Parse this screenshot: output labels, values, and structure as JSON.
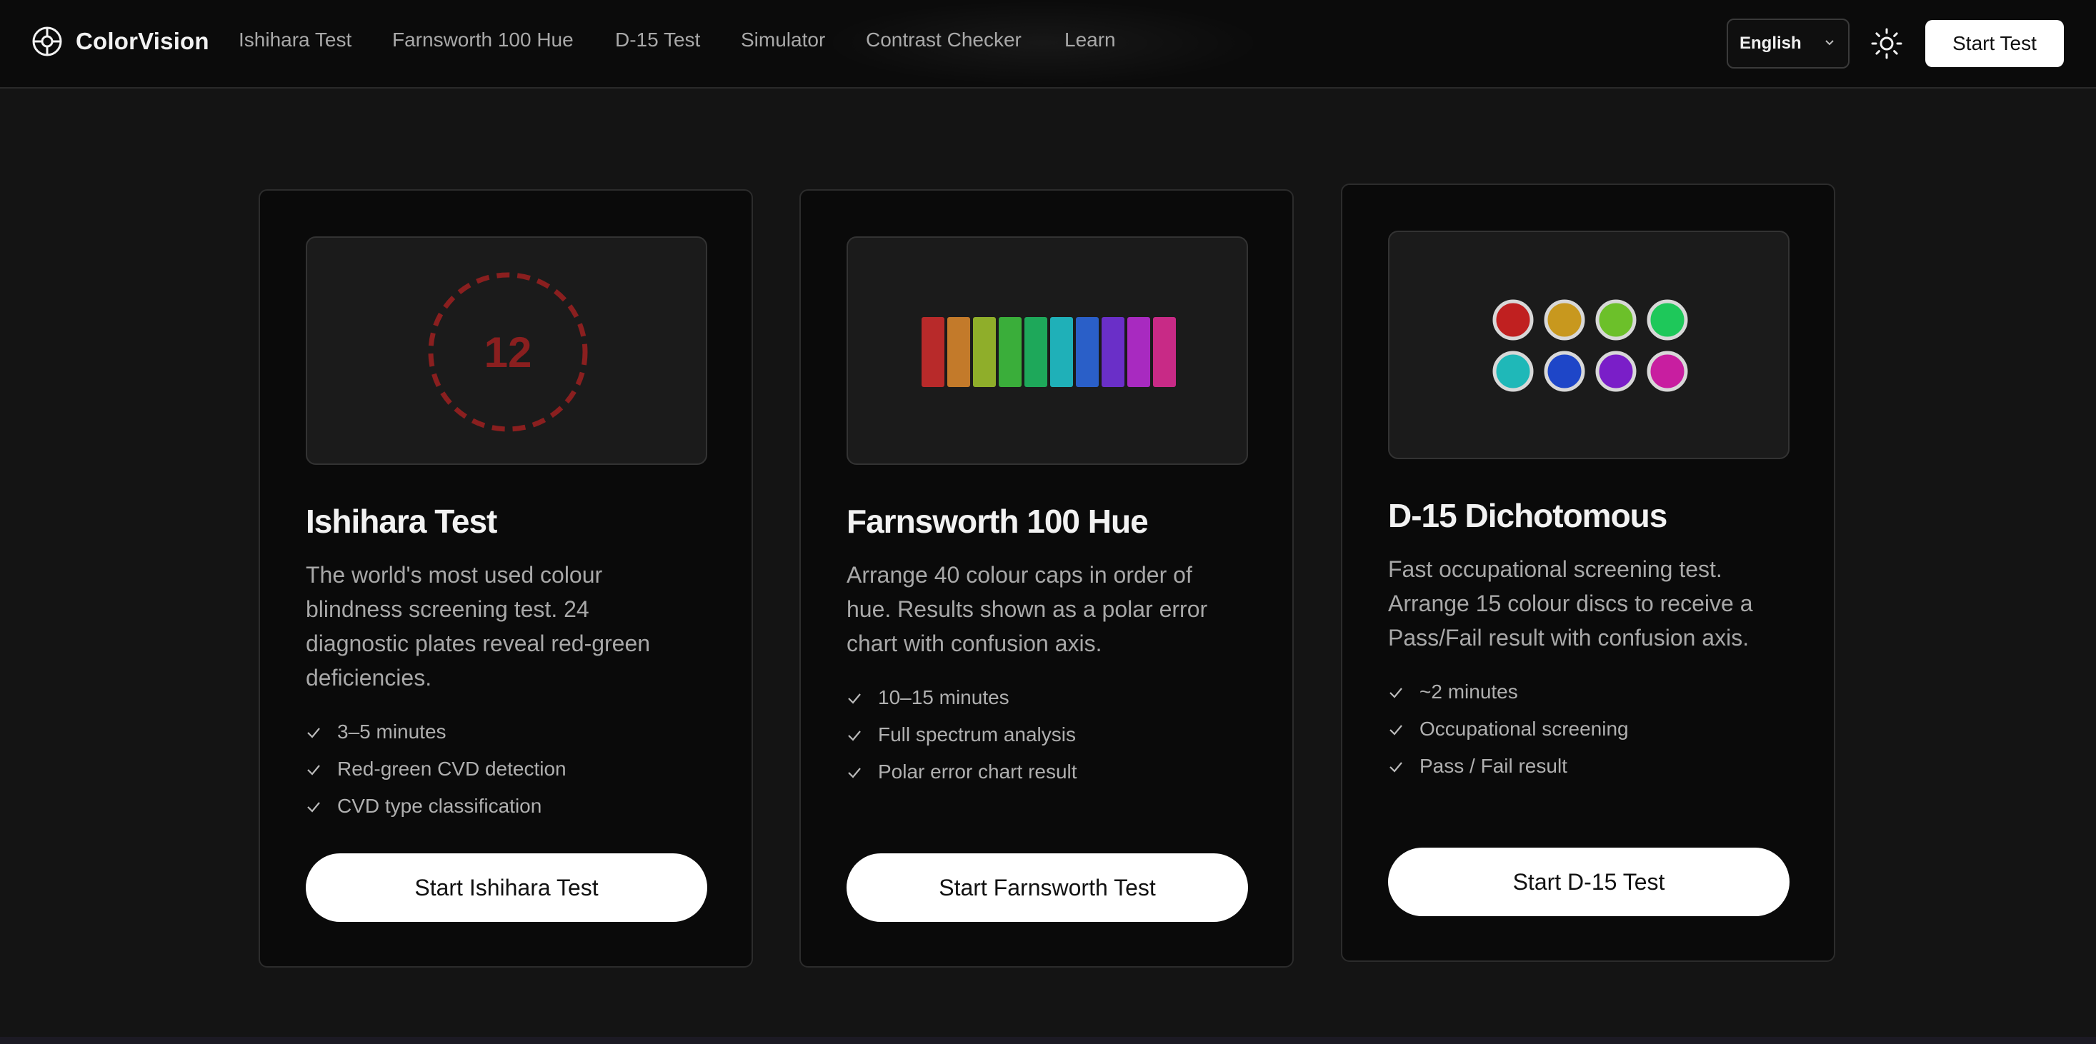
{
  "nav": {
    "brand": "ColorVision",
    "links": [
      "Ishihara Test",
      "Farnsworth 100 Hue",
      "D-15 Test",
      "Simulator",
      "Contrast Checker",
      "Learn"
    ],
    "language": "English",
    "start_label": "Start Test",
    "icons": {
      "brand": "color-wheel-icon",
      "theme": "sun-icon",
      "dropdown": "chevron-down-icon"
    }
  },
  "cards": [
    {
      "title": "Ishihara Test",
      "description": "The world's most used colour blindness screening test. 24 diagnostic plates reveal red-green deficiencies.",
      "preview_number": "12",
      "features": [
        "3–5 minutes",
        "Red-green CVD detection",
        "CVD type classification"
      ],
      "button": "Start Ishihara Test"
    },
    {
      "title": "Farnsworth 100 Hue",
      "description": "Arrange 40 colour caps in order of hue. Results shown as a polar error chart with confusion axis.",
      "features": [
        "10–15 minutes",
        "Full spectrum analysis",
        "Polar error chart result"
      ],
      "button": "Start Farnsworth Test",
      "hue_colors": [
        "#b82a2a",
        "#c37a2a",
        "#8fae2a",
        "#3aae3a",
        "#1ea85a",
        "#1fb0b8",
        "#2a5fc8",
        "#6a2fc8",
        "#a82ac0",
        "#c82a86"
      ]
    },
    {
      "title": "D-15 Dichotomous",
      "description": "Fast occupational screening test. Arrange 15 colour discs to receive a Pass/Fail result with confusion axis.",
      "features": [
        "~2 minutes",
        "Occupational screening",
        "Pass / Fail result"
      ],
      "button": "Start D-15 Test",
      "disc_colors": [
        "#c02020",
        "#c8981e",
        "#6cc02a",
        "#1ec85a",
        "#1fb8b8",
        "#1e46c8",
        "#7a1ec8",
        "#c81ea0"
      ]
    }
  ],
  "colors": {
    "accent": "#ffffff",
    "ishihara_red": "#8a1f1f"
  }
}
